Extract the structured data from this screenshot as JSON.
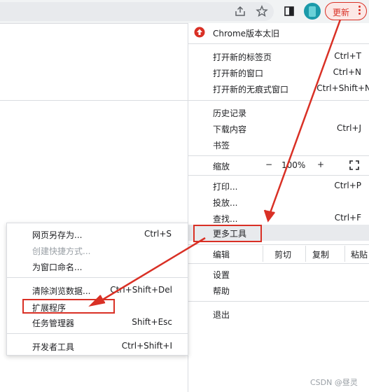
{
  "toolbar": {
    "update_label": "更新",
    "icons": [
      "share-icon",
      "star-icon",
      "sidebar-icon",
      "avatar",
      "kebab-menu-icon"
    ]
  },
  "menu": {
    "update_notice": "Chrome版本太旧",
    "new_tab": {
      "label": "打开新的标签页",
      "shortcut": "Ctrl+T"
    },
    "new_window": {
      "label": "打开新的窗口",
      "shortcut": "Ctrl+N"
    },
    "new_incognito": {
      "label": "打开新的无痕式窗口",
      "shortcut": "Ctrl+Shift+N"
    },
    "history": {
      "label": "历史记录"
    },
    "downloads": {
      "label": "下载内容",
      "shortcut": "Ctrl+J"
    },
    "bookmarks": {
      "label": "书签"
    },
    "zoom": {
      "label": "缩放",
      "minus": "−",
      "value": "100%",
      "plus": "+"
    },
    "print": {
      "label": "打印...",
      "shortcut": "Ctrl+P"
    },
    "cast": {
      "label": "投放..."
    },
    "find": {
      "label": "查找...",
      "shortcut": "Ctrl+F"
    },
    "more_tools": {
      "label": "更多工具"
    },
    "edit": {
      "label": "编辑",
      "cut": "剪切",
      "copy": "复制",
      "paste": "粘贴"
    },
    "settings": {
      "label": "设置"
    },
    "help": {
      "label": "帮助"
    },
    "exit": {
      "label": "退出"
    }
  },
  "submenu": {
    "save_page": {
      "label": "网页另存为...",
      "shortcut": "Ctrl+S"
    },
    "create_shortcut": {
      "label": "创建快捷方式..."
    },
    "name_window": {
      "label": "为窗口命名..."
    },
    "clear_data": {
      "label": "清除浏览数据...",
      "shortcut": "Ctrl+Shift+Del"
    },
    "extensions": {
      "label": "扩展程序"
    },
    "task_manager": {
      "label": "任务管理器",
      "shortcut": "Shift+Esc"
    },
    "dev_tools": {
      "label": "开发者工具",
      "shortcut": "Ctrl+Shift+I"
    }
  },
  "watermark": "CSDN @昼灵",
  "colors": {
    "accent_red": "#d93025",
    "menu_bg": "#ffffff",
    "toolbar_bg": "#f1f3f4",
    "separator": "#dadce0"
  }
}
